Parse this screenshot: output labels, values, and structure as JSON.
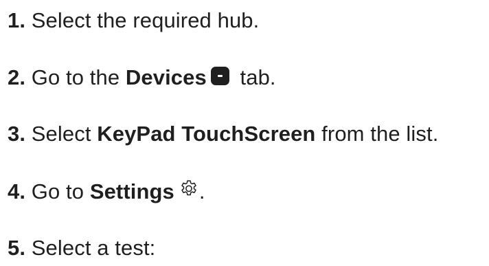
{
  "steps": [
    {
      "number": "1.",
      "before": " Select the required hub.",
      "bold": "",
      "after": ""
    },
    {
      "number": "2.",
      "before": " Go to the ",
      "bold": "Devices",
      "after": " tab.",
      "icon": "devices-tab-icon"
    },
    {
      "number": "3.",
      "before": " Select ",
      "bold": "KeyPad TouchScreen",
      "after": " from the list."
    },
    {
      "number": "4.",
      "before": " Go to ",
      "bold": "Settings",
      "after": ".",
      "icon": "gear-icon"
    },
    {
      "number": "5.",
      "before": " Select a test:",
      "bold": "",
      "after": ""
    }
  ]
}
